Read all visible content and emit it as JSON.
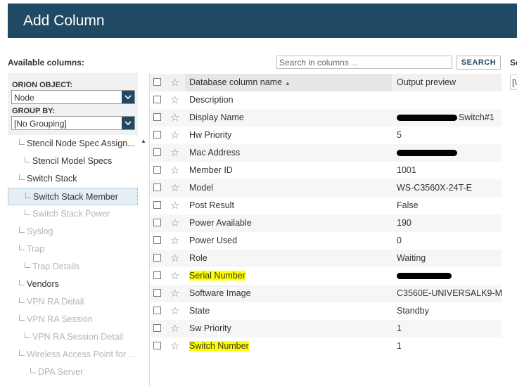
{
  "header": {
    "title": "Add Column"
  },
  "available_label": "Available columns:",
  "search": {
    "placeholder": "Search in columns ...",
    "button": "SEARCH"
  },
  "right_fragment": {
    "label": "Se",
    "box": "[\\"
  },
  "left": {
    "orion_label": "ORION OBJECT:",
    "orion_value": "Node",
    "group_label": "GROUP BY:",
    "group_value": "[No Grouping]",
    "tree": [
      {
        "label": "Stencil Node Spec Assign...",
        "dim": false
      },
      {
        "label": "Stencil Model Specs",
        "dim": false
      },
      {
        "label": "Switch Stack",
        "dim": false
      },
      {
        "label": "Switch Stack Member",
        "dim": false,
        "selected": true
      },
      {
        "label": "Switch Stack Power",
        "dim": true
      },
      {
        "label": "Syslog",
        "dim": true
      },
      {
        "label": "Trap",
        "dim": true
      },
      {
        "label": "Trap Details",
        "dim": true
      },
      {
        "label": "Vendors",
        "dim": false
      },
      {
        "label": "VPN RA Detail",
        "dim": true
      },
      {
        "label": "VPN RA Session",
        "dim": true
      },
      {
        "label": "VPN RA Session Detail",
        "dim": true
      },
      {
        "label": "Wireless Access Point for ...",
        "dim": true
      },
      {
        "label": "DPA Server",
        "dim": true
      }
    ]
  },
  "grid": {
    "col_name": "Database column name",
    "col_preview": "Output preview",
    "rows": [
      {
        "name": "Description",
        "preview": ""
      },
      {
        "name": "Display Name",
        "preview": "Switch#1"
      },
      {
        "name": "Hw Priority",
        "preview": "5"
      },
      {
        "name": "Mac Address",
        "preview": ""
      },
      {
        "name": "Member ID",
        "preview": "1001"
      },
      {
        "name": "Model",
        "preview": "WS-C3560X-24T-E"
      },
      {
        "name": "Post Result",
        "preview": "False"
      },
      {
        "name": "Power Available",
        "preview": "190"
      },
      {
        "name": "Power Used",
        "preview": "0"
      },
      {
        "name": "Role",
        "preview": "Waiting"
      },
      {
        "name": "Serial Number",
        "preview": ""
      },
      {
        "name": "Software Image",
        "preview": "C3560E-UNIVERSALK9-M"
      },
      {
        "name": "State",
        "preview": "Standby"
      },
      {
        "name": "Sw Priority",
        "preview": "1"
      },
      {
        "name": "Switch Number",
        "preview": "1"
      }
    ]
  }
}
